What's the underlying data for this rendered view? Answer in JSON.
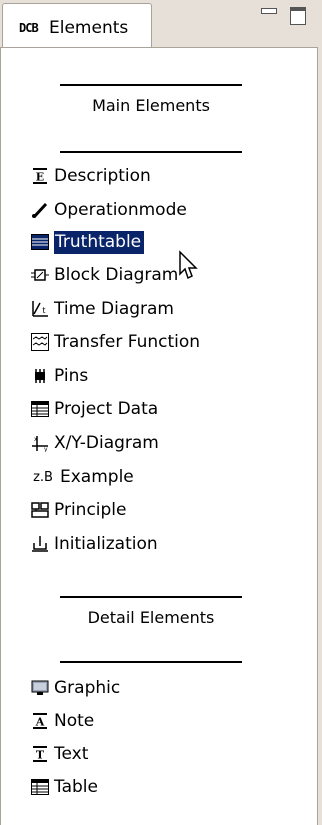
{
  "panel": {
    "tab_icon": "DCB",
    "tab_title": "Elements",
    "buttons": [
      "minimize-icon",
      "maximize-icon"
    ]
  },
  "sections": {
    "main_title": "Main Elements",
    "detail_title": "Detail Elements"
  },
  "main_items": [
    {
      "label": "Description",
      "icon": "description-icon"
    },
    {
      "label": "Operationmode",
      "icon": "pen-icon"
    },
    {
      "label": "Truthtable",
      "icon": "truthtable-icon",
      "selected": true
    },
    {
      "label": "Block Diagram",
      "icon": "block-diagram-icon"
    },
    {
      "label": "Time Diagram",
      "icon": "time-diagram-icon"
    },
    {
      "label": "Transfer Function",
      "icon": "transfer-function-icon"
    },
    {
      "label": "Pins",
      "icon": "pins-icon"
    },
    {
      "label": "Project Data",
      "icon": "project-data-icon"
    },
    {
      "label": "X/Y-Diagram",
      "icon": "xy-diagram-icon"
    },
    {
      "label": "Example",
      "icon": "example-icon",
      "icon_text": "z.B"
    },
    {
      "label": "Principle",
      "icon": "principle-icon"
    },
    {
      "label": "Initialization",
      "icon": "initialization-icon"
    }
  ],
  "detail_items": [
    {
      "label": "Graphic",
      "icon": "graphic-icon"
    },
    {
      "label": "Note",
      "icon": "note-icon"
    },
    {
      "label": "Text",
      "icon": "text-icon"
    },
    {
      "label": "Table",
      "icon": "table-icon"
    }
  ],
  "colors": {
    "selection_bg": "#0a246a",
    "selection_fg": "#ffffff",
    "tabstrip_bg": "#e6e0d8"
  }
}
